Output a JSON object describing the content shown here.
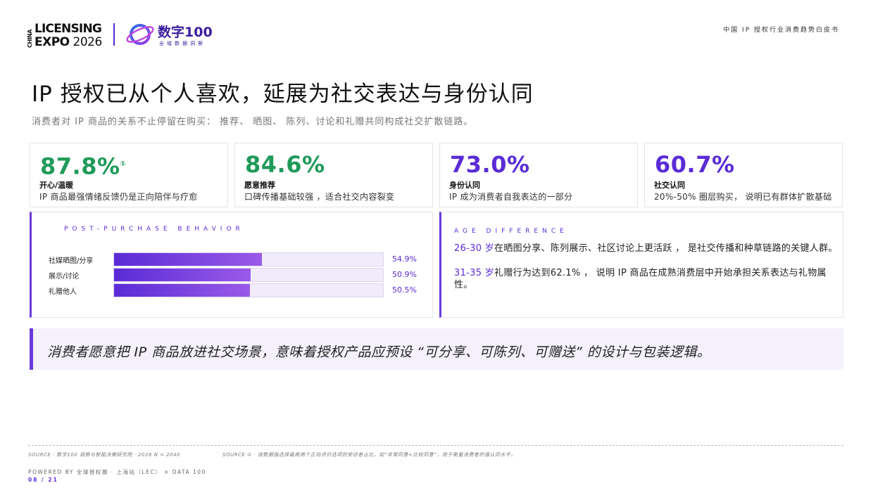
{
  "header": {
    "licensing_logo": {
      "china": "CHINA",
      "line1": "LICENSING",
      "line2_bold": "EXPO",
      "line2_year": "2026"
    },
    "partner_logo": {
      "title": "数字100",
      "subtitle": "全域数据洞察"
    },
    "doc_title": "中国 IP 授权行业消费趋势白皮书"
  },
  "heading": {
    "title": "IP 授权已从个人喜欢，延展为社交表达与身份认同",
    "subtitle": "消费者对 IP 商品的关系不止停留在购买： 推荐、 晒图、 陈列、讨论和礼赠共同构成社交扩散链路。"
  },
  "stats": [
    {
      "value": "87.8%",
      "note_mark": "①",
      "label": "开心/温暖",
      "desc": "IP 商品最强情绪反馈仍是正向陪伴与疗愈",
      "color": "#1f9a5a"
    },
    {
      "value": "84.6%",
      "label": "愿意推荐",
      "desc": "口碑传播基础较强 ，适合社交内容裂变",
      "color": "#1f9a5a"
    },
    {
      "value": "73.0%",
      "label": "身份认同",
      "desc": "IP 成为消费者自我表达的一部分",
      "color": "#5a2bd6"
    },
    {
      "value": "60.7%",
      "label": "社交认同",
      "desc": "20%-50% 圈层购买， 说明已有群体扩散基础",
      "color": "#5a2bd6"
    }
  ],
  "behavior_panel": {
    "heading": "POST-PURCHASE BEHAVIOR",
    "bars": [
      {
        "label": "社媒晒图/分享",
        "value": 54.9,
        "display": "54.9%"
      },
      {
        "label": "展示/讨论",
        "value": 50.9,
        "display": "50.9%"
      },
      {
        "label": "礼赠他人",
        "value": 50.5,
        "display": "50.5%"
      }
    ]
  },
  "age_panel": {
    "heading": "AGE DIFFERENCE",
    "p1_highlight": "26-30 岁",
    "p1_text": "在晒图分享、陈列展示、社区讨论上更活跃 ， 是社交传播和种草链路的关键人群。",
    "p2_highlight": "31-35 岁",
    "p2_text": "礼赠行为达到62.1% ， 说明 IP 商品在成熟消费层中开始承担关系表达与礼物属性。"
  },
  "quote": "消费者愿意把 IP 商品放进社交场景，意味着授权产品应预设 “可分享、可陈列、可赠送” 的设计与包装逻辑。",
  "footer": {
    "source1": "SOURCE · 数字100 调察与智能决策研究院 · 2026 N = 2040",
    "source2": "SOURCE ① · 该数据指选择最高两个正向评价选项的受访者占比，如“非常同意+比较同意”，用于衡量消费者的强认同水平。",
    "powered": "POWERED BY 全球授权展 · 上海站（LEC） × DATA 100",
    "page": "08 / 21"
  }
}
